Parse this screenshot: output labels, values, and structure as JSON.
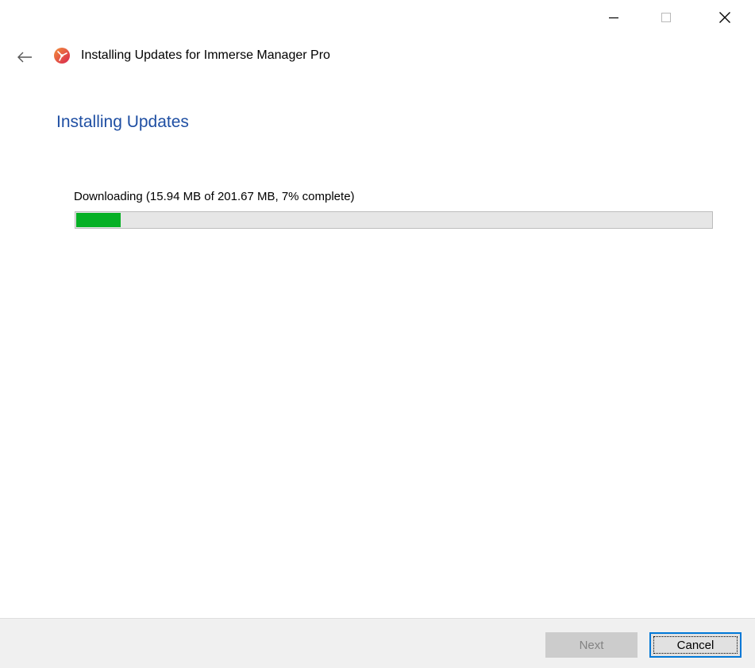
{
  "window": {
    "title": "Installing Updates for Immerse Manager Pro",
    "caption": {
      "minimize_icon": "minimize-icon",
      "maximize_icon": "maximize-icon",
      "close_icon": "close-icon"
    }
  },
  "page": {
    "heading": "Installing Updates",
    "status": "Downloading (15.94 MB of 201.67 MB, 7% complete)",
    "progress_percent": 7
  },
  "footer": {
    "next_label": "Next",
    "cancel_label": "Cancel"
  },
  "colors": {
    "heading": "#1f4fa3",
    "progress_fill": "#06b025",
    "focus_border": "#0078d7"
  }
}
